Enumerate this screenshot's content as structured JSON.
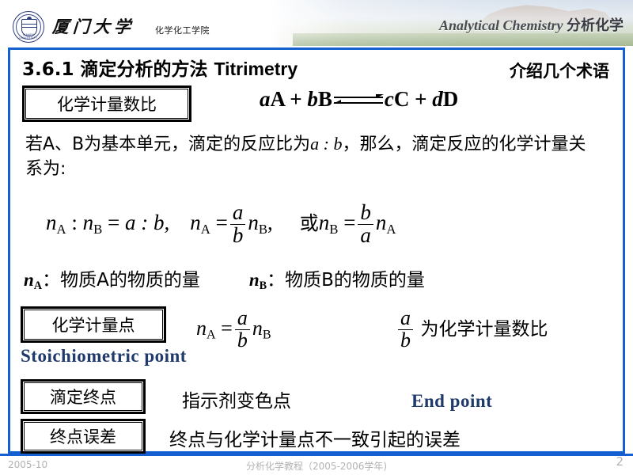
{
  "header": {
    "logo_alt": "厦门大学",
    "university_name": "厦门大学",
    "college_name": "化学化工学院",
    "course_en": "Analytical Chemistry",
    "course_cn": "分析化学"
  },
  "slide": {
    "title": "3.6.1  滴定分析的方法 ",
    "title_en": "Titrimetry",
    "terms_note": "介绍几个术语",
    "reaction": {
      "left_coef_a": "a",
      "left_species_A": "A",
      "plus1": "+",
      "left_coef_b": "b",
      "left_species_B": "B",
      "arrow": "⇌",
      "right_coef_c": "c",
      "right_species_C": "C",
      "plus2": "+",
      "right_coef_d": "d",
      "right_species_D": "D"
    },
    "intro_paragraph_part1": "若A、B为基本单元，滴定的反应比为",
    "intro_ratio": "a : b",
    "intro_paragraph_part2": "，那么，滴定反应的化学计量关系为:",
    "equation_row": {
      "expr1": "n",
      "expr1_sub": "A",
      "colon": " : ",
      "expr2": "n",
      "expr2_sub": "B",
      "equals": " = ",
      "ratio": "a : b,",
      "expr3": "n",
      "expr3_sub": "A",
      "equals2": "=",
      "frac_num": "a",
      "frac_den": "b",
      "expr4": "n",
      "expr4_sub": "B",
      "comma": ",",
      "or_cn": "或",
      "expr5": "n",
      "expr5_sub": "B",
      "equals3": "=",
      "frac2_num": "b",
      "frac2_den": "a",
      "expr6": "n",
      "expr6_sub": "A"
    },
    "definitions": {
      "nA_symbol": "n",
      "nA_sub": "A",
      "nA_text": "：物质A的物质的量",
      "nB_symbol": "n",
      "nB_sub": "B",
      "nB_text": "：物质B的物质的量"
    },
    "boxes": {
      "ratio_label": "化学计量数比",
      "point_label": "化学计量点",
      "endpoint_label": "滴定终点",
      "enderror_label": "终点误差"
    },
    "stoich_equation": {
      "lhs": "n",
      "lhs_sub": "A",
      "equals": "=",
      "frac_num": "a",
      "frac_den": "b",
      "rhs": "n",
      "rhs_sub": "B"
    },
    "ratio_note": {
      "frac_num": "a",
      "frac_den": "b",
      "text": "为化学计量数比"
    },
    "stoichiometric_point_en": "Stoichiometric point",
    "end_point_en": "End  point",
    "endpoint_desc": "指示剂变色点",
    "enderror_desc": "终点与化学计量点不一致引起的误差"
  },
  "footer": {
    "date": "2005-10",
    "course": "分析化学教程（2005-2006学年)",
    "page_number": "2"
  },
  "colors": {
    "frame_blue": "#1560d0",
    "accent_navy": "#1f3a6b",
    "footer_gray": "#b3b3b3"
  }
}
